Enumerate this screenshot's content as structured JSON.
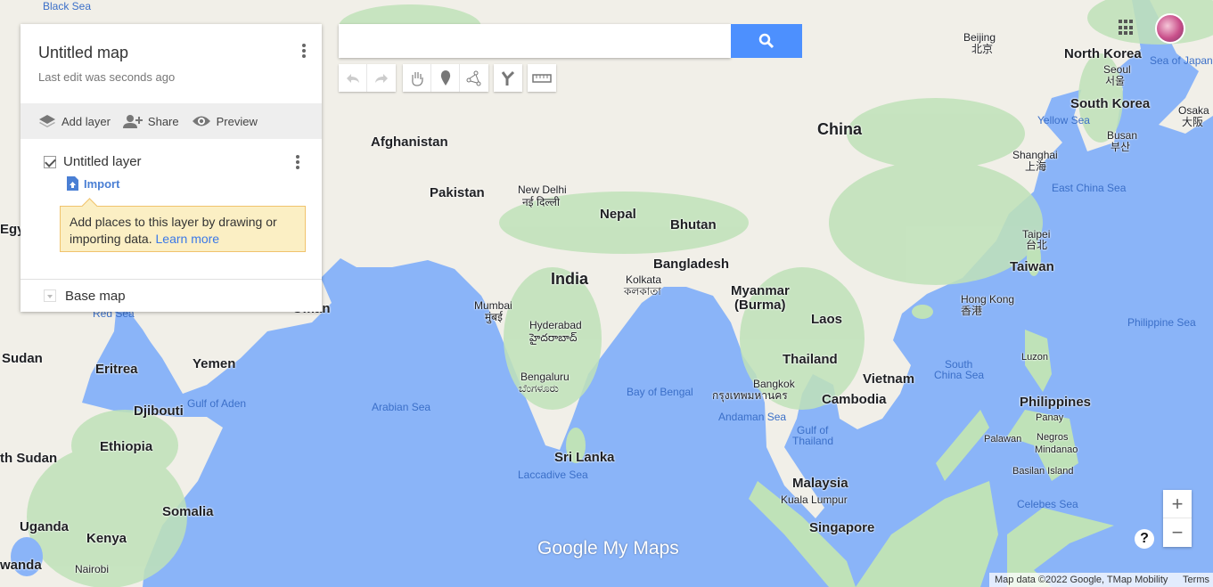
{
  "panel": {
    "title": "Untitled map",
    "subtitle": "Last edit was seconds ago",
    "actions": {
      "add_layer": "Add layer",
      "share": "Share",
      "preview": "Preview"
    },
    "layer": {
      "name": "Untitled layer",
      "checked": true,
      "import": "Import"
    },
    "tip": {
      "text": "Add places to this layer by drawing or importing data.",
      "link": "Learn more"
    },
    "base_map": "Base map"
  },
  "search": {
    "value": "",
    "placeholder": ""
  },
  "toolbar": [
    "undo-icon",
    "redo-icon",
    "hand-icon",
    "marker-icon",
    "draw-line-icon",
    "directions-icon",
    "ruler-icon"
  ],
  "zoom": {
    "in": "+",
    "out": "−"
  },
  "help": "?",
  "attribution": {
    "text": "Map data ©2022 Google, TMap Mobility",
    "terms": "Terms"
  },
  "logo": {
    "google": "Google",
    "mymaps": "My Maps"
  },
  "colors": {
    "sea": "#8ab4f8",
    "land": "#f1efe8",
    "vegetation": "#bfe2b8",
    "search_button": "#4d90fe",
    "tip_bg": "#fbefc4"
  },
  "map_labels": [
    "Black Sea",
    "Afghanistan",
    "Pakistan",
    "New Delhi",
    "नई दिल्ली",
    "Nepal",
    "Bhutan",
    "China",
    "Beijing",
    "北京",
    "North Korea",
    "Seoul",
    "서울",
    "South Korea",
    "Busan",
    "부산",
    "Osaka",
    "大阪",
    "Sea of Japan",
    "Yellow Sea",
    "Shanghai",
    "上海",
    "East China Sea",
    "Taipei",
    "台北",
    "Taiwan",
    "Hong Kong",
    "香港",
    "Philippine Sea",
    "India",
    "Bangladesh",
    "Kolkata",
    "কলকাতা",
    "Mumbai",
    "मुंबई",
    "Hyderabad",
    "హైదరాబాద్",
    "Bengaluru",
    "ಬೆಂಗಳೂರು",
    "Myanmar",
    "(Burma)",
    "Laos",
    "Thailand",
    "Bangkok",
    "กรุงเทพมหานคร",
    "Vietnam",
    "Cambodia",
    "Andaman Sea",
    "Gulf of",
    "Thailand",
    "South",
    "China Sea",
    "Luzon",
    "Philippines",
    "Panay",
    "Palawan",
    "Negros",
    "Mindanao",
    "Basilan Island",
    "Malaysia",
    "Kuala Lumpur",
    "Singapore",
    "Celebes Sea",
    "Sri Lanka",
    "Laccadive Sea",
    "Arabian Sea",
    "Bay of Bengal",
    "Oman",
    "Yemen",
    "Gulf of Aden",
    "Red Sea",
    "Eritrea",
    "Sudan",
    "Djibouti",
    "Ethiopia",
    "th Sudan",
    "Somalia",
    "Uganda",
    "Kenya",
    "Nairobi",
    "wanda",
    "Egy"
  ]
}
